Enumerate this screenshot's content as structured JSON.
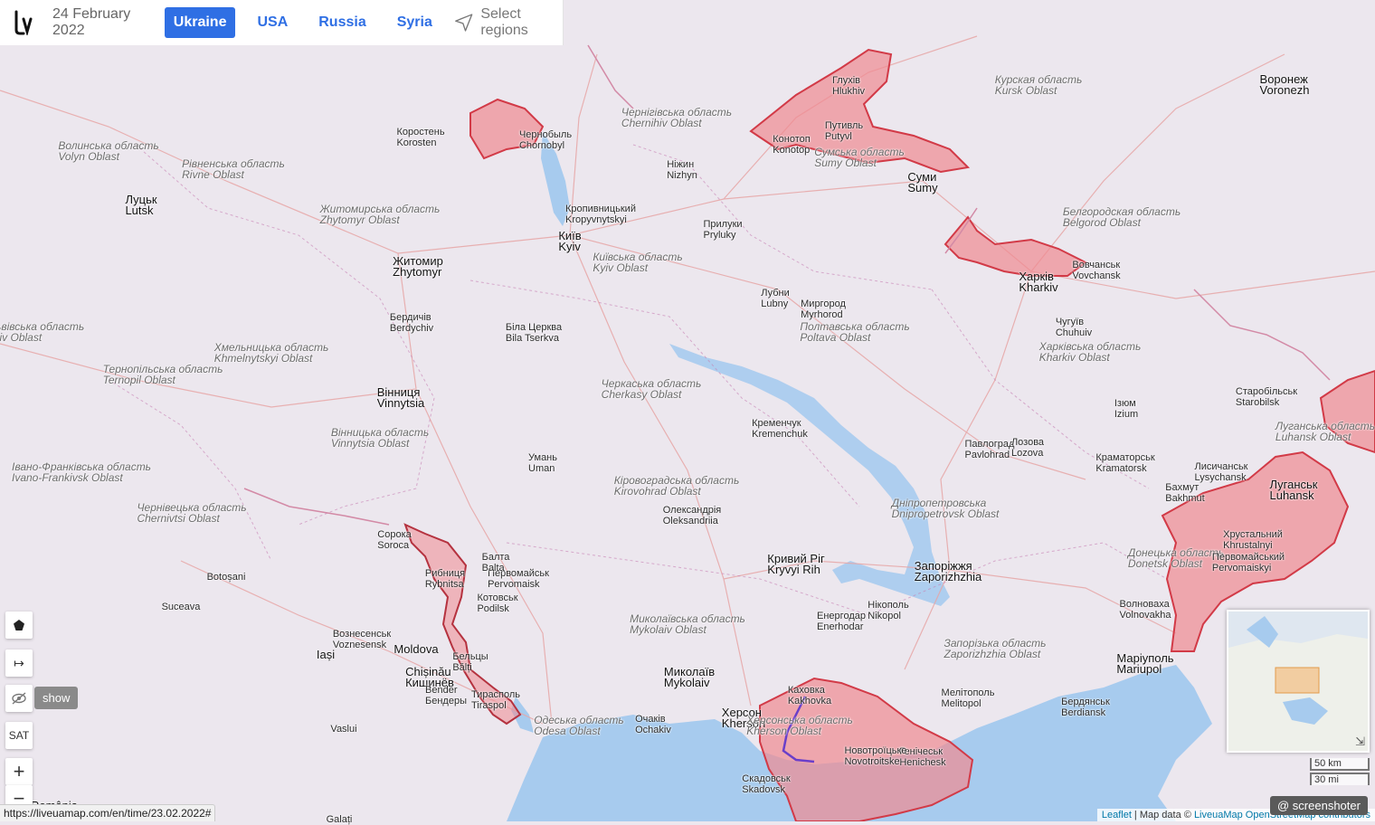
{
  "header": {
    "date": "24 February 2022",
    "regions": [
      "Ukraine",
      "USA",
      "Russia",
      "Syria"
    ],
    "active_region": "Ukraine",
    "select_regions_label": "Select regions"
  },
  "controls": {
    "show_label": "show",
    "sat_label": "SAT",
    "zoom_in_label": "+",
    "zoom_out_label": "−"
  },
  "status_url": "https://liveuamap.com/en/time/23.02.2022#",
  "attribution": {
    "leaflet": "Leaflet",
    "separator": " | Map data © ",
    "provider": "LiveuaMap OpenStreetMap contributors"
  },
  "scale": {
    "metric": "50 km",
    "imperial": "30 mi"
  },
  "screenshoter": "@ screenshoter",
  "colors": {
    "accent": "#2f6fe4",
    "occupied_fill": "#f08a92",
    "occupied_stroke": "#d23a47",
    "water": "#a7cbee",
    "land": "#ece7ee"
  },
  "map_labels": [
    {
      "name": "Київ",
      "sub": "Kyiv",
      "big": true
    },
    {
      "name": "Житомир",
      "sub": "Zhytomyr",
      "big": true
    },
    {
      "name": "Вінниця",
      "sub": "Vinnytsia",
      "big": true
    },
    {
      "name": "Харків",
      "sub": "Kharkiv",
      "big": true
    },
    {
      "name": "Суми",
      "sub": "Sumy",
      "big": true
    },
    {
      "name": "Запоріжжя",
      "sub": "Zaporizhzhia",
      "big": true
    },
    {
      "name": "Кривий Ріг",
      "sub": "Kryvyi Rih",
      "big": true
    },
    {
      "name": "Миколаїв",
      "sub": "Mykolaiv",
      "big": true
    },
    {
      "name": "Херсон",
      "sub": "Kherson",
      "big": true
    },
    {
      "name": "Маріуполь",
      "sub": "Mariupol",
      "big": true
    },
    {
      "name": "Луганськ",
      "sub": "Luhansk",
      "big": true
    },
    {
      "name": "Chișinău",
      "sub": "Кишинёв",
      "big": true
    },
    {
      "name": "Moldova",
      "sub": "",
      "big": true
    },
    {
      "name": "Iași",
      "sub": "",
      "big": true
    },
    {
      "name": "Луцьк",
      "sub": "Lutsk",
      "big": true
    },
    {
      "name": "Воронеж",
      "sub": "Voronezh",
      "big": true
    },
    {
      "name": "Дніпропетровська",
      "sub": "Dnipropetrovsk Oblast",
      "big": false
    },
    {
      "name": "Черкаська область",
      "sub": "Cherkasy Oblast",
      "big": false
    },
    {
      "name": "Кіровоградська область",
      "sub": "Kirovohrad Oblast",
      "big": false
    },
    {
      "name": "Полтавська область",
      "sub": "Poltava Oblast",
      "big": false
    },
    {
      "name": "Київська область",
      "sub": "Kyiv Oblast",
      "big": false
    },
    {
      "name": "Чернігівська область",
      "sub": "Chernihiv Oblast",
      "big": false
    },
    {
      "name": "Сумська область",
      "sub": "Sumy Oblast",
      "big": false
    },
    {
      "name": "Харківська область",
      "sub": "Kharkiv Oblast",
      "big": false
    },
    {
      "name": "Житомирська область",
      "sub": "Zhytomyr Oblast",
      "big": false
    },
    {
      "name": "Вінницька область",
      "sub": "Vinnytsia Oblast",
      "big": false
    },
    {
      "name": "Хмельницька область",
      "sub": "Khmelnytskyi Oblast",
      "big": false
    },
    {
      "name": "Миколаївська область",
      "sub": "Mykolaiv Oblast",
      "big": false
    },
    {
      "name": "Одеська область",
      "sub": "Odesa Oblast",
      "big": false
    },
    {
      "name": "Херсонська область",
      "sub": "Kherson Oblast",
      "big": false
    },
    {
      "name": "Запорізька область",
      "sub": "Zaporizhzhia Oblast",
      "big": false
    },
    {
      "name": "Донецька область",
      "sub": "Donetsk Oblast",
      "big": false
    },
    {
      "name": "Луганська область",
      "sub": "Luhansk Oblast",
      "big": false
    },
    {
      "name": "Белгородская область",
      "sub": "Belgorod Oblast",
      "big": false
    },
    {
      "name": "Курская область",
      "sub": "Kursk Oblast",
      "big": false
    },
    {
      "name": "Волинська область",
      "sub": "Volyn Oblast",
      "big": false
    },
    {
      "name": "Рівненська область",
      "sub": "Rivne Oblast",
      "big": false
    },
    {
      "name": "Тернопільська область",
      "sub": "Ternopil Oblast",
      "big": false
    },
    {
      "name": "Івано-Франківська область",
      "sub": "Ivano-Frankivsk Oblast",
      "big": false
    },
    {
      "name": "Чернівецька область",
      "sub": "Chernivtsi Oblast",
      "big": false
    },
    {
      "name": "Львівська область",
      "sub": "Lviv Oblast",
      "big": false
    },
    {
      "name": "Умань",
      "sub": "Uman",
      "big": false
    },
    {
      "name": "Біла Церква",
      "sub": "Bila Tserkva",
      "big": false
    },
    {
      "name": "Кременчук",
      "sub": "Kremenchuk",
      "big": false
    },
    {
      "name": "Нікополь",
      "sub": "Nikopol",
      "big": false
    },
    {
      "name": "Бердянськ",
      "sub": "Berdiansk",
      "big": false
    },
    {
      "name": "Мелітополь",
      "sub": "Melitopol",
      "big": false
    },
    {
      "name": "Генічеськ",
      "sub": "Henichesk",
      "big": false
    },
    {
      "name": "Новотроїцьке",
      "sub": "Novotroitske",
      "big": false
    },
    {
      "name": "Скадовськ",
      "sub": "Skadovsk",
      "big": false
    },
    {
      "name": "Каховка",
      "sub": "Kakhovka",
      "big": false
    },
    {
      "name": "Очаків",
      "sub": "Ochakiv",
      "big": false
    },
    {
      "name": "Тирасполь",
      "sub": "Tiraspol",
      "big": false
    },
    {
      "name": "Рибниця",
      "sub": "Rybnitsa",
      "big": false
    },
    {
      "name": "Путивль",
      "sub": "Putyvl",
      "big": false
    },
    {
      "name": "Глухів",
      "sub": "Hlukhiv",
      "big": false
    },
    {
      "name": "Конотоп",
      "sub": "Konotop",
      "big": false
    },
    {
      "name": "Ніжин",
      "sub": "Nizhyn",
      "big": false
    },
    {
      "name": "Прилуки",
      "sub": "Pryluky",
      "big": false
    },
    {
      "name": "Лубни",
      "sub": "Lubny",
      "big": false
    },
    {
      "name": "Миргород",
      "sub": "Myrhorod",
      "big": false
    },
    {
      "name": "Чернобыль",
      "sub": "Chornobyl",
      "big": false
    },
    {
      "name": "Бердичів",
      "sub": "Berdychiv",
      "big": false
    },
    {
      "name": "Коростень",
      "sub": "Korosten",
      "big": false
    },
    {
      "name": "Ізюм",
      "sub": "Izium",
      "big": false
    },
    {
      "name": "Краматорськ",
      "sub": "Kramatorsk",
      "big": false
    },
    {
      "name": "Лисичанськ",
      "sub": "Lysychansk",
      "big": false
    },
    {
      "name": "Бахмут",
      "sub": "Bakhmut",
      "big": false
    },
    {
      "name": "Волноваха",
      "sub": "Volnovakha",
      "big": false
    },
    {
      "name": "Павлоград",
      "sub": "Pavlohrad",
      "big": false
    },
    {
      "name": "Лозова",
      "sub": "Lozova",
      "big": false
    },
    {
      "name": "Чугуїв",
      "sub": "Chuhuiv",
      "big": false
    },
    {
      "name": "Вовчанськ",
      "sub": "Vovchansk",
      "big": false
    },
    {
      "name": "Старобільськ",
      "sub": "Starobilsk",
      "big": false
    },
    {
      "name": "Хрустальний",
      "sub": "Khrustalnyi",
      "big": false
    },
    {
      "name": "Первомайський",
      "sub": "Pervomaiskyi",
      "big": false
    },
    {
      "name": "Енергодар",
      "sub": "Enerhodar",
      "big": false
    },
    {
      "name": "Олександрія",
      "sub": "Oleksandriia",
      "big": false
    },
    {
      "name": "Кропивницький",
      "sub": "Kropyvnytskyi",
      "big": false
    },
    {
      "name": "Первомайськ",
      "sub": "Pervomaisk",
      "big": false
    },
    {
      "name": "Вознесенськ",
      "sub": "Voznesensk",
      "big": false
    },
    {
      "name": "Балта",
      "sub": "Balta",
      "big": false
    },
    {
      "name": "Котовськ",
      "sub": "Podilsk",
      "big": false
    },
    {
      "name": "Бельцы",
      "sub": "Bălți",
      "big": false
    },
    {
      "name": "Сорока",
      "sub": "Soroca",
      "big": false
    },
    {
      "name": "Bender",
      "sub": "Бендеры",
      "big": false
    },
    {
      "name": "România",
      "sub": "",
      "big": true
    },
    {
      "name": "Galați",
      "sub": "",
      "big": false
    },
    {
      "name": "Vaslui",
      "sub": "",
      "big": false
    },
    {
      "name": "Suceava",
      "sub": "",
      "big": false
    },
    {
      "name": "Botoșani",
      "sub": "",
      "big": false
    }
  ]
}
